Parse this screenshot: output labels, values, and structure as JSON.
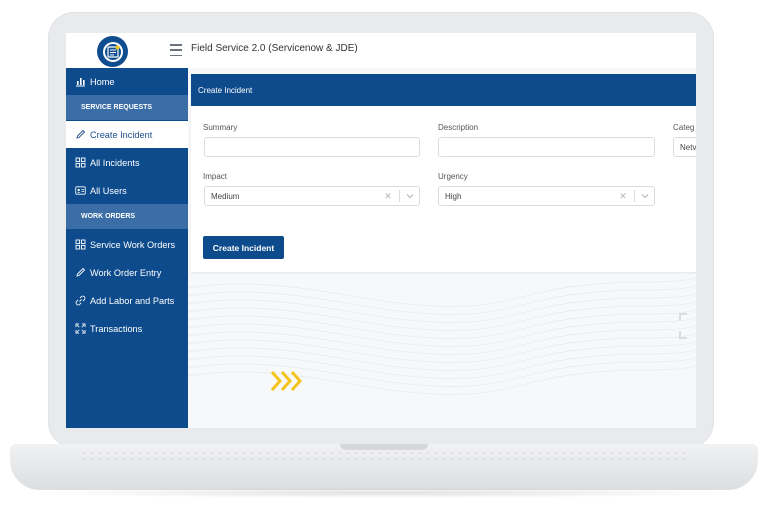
{
  "app": {
    "title": "Field Service 2.0 (Servicenow & JDE)"
  },
  "sidebar": {
    "items": [
      {
        "type": "link",
        "label": "Home",
        "icon": "chart-icon"
      },
      {
        "type": "section",
        "label": "SERVICE REQUESTS"
      },
      {
        "type": "link",
        "label": "Create Incident",
        "icon": "pencil-icon",
        "active": true
      },
      {
        "type": "link",
        "label": "All Incidents",
        "icon": "grid-icon"
      },
      {
        "type": "link",
        "label": "All Users",
        "icon": "id-card-icon"
      },
      {
        "type": "section",
        "label": "WORK ORDERS"
      },
      {
        "type": "link",
        "label": "Service Work Orders",
        "icon": "grid-icon"
      },
      {
        "type": "link",
        "label": "Work Order Entry",
        "icon": "pencil-icon"
      },
      {
        "type": "link",
        "label": "Add Labor and Parts",
        "icon": "link-icon"
      },
      {
        "type": "link",
        "label": "Transactions",
        "icon": "expand-icon"
      }
    ]
  },
  "form": {
    "header": "Create Incident",
    "summary": {
      "label": "Summary",
      "value": ""
    },
    "description": {
      "label": "Description",
      "value": ""
    },
    "category": {
      "label": "Categ",
      "value": "Netv"
    },
    "impact": {
      "label": "Impact",
      "value": "Medium"
    },
    "urgency": {
      "label": "Urgency",
      "value": "High"
    },
    "submit_label": "Create Incident"
  },
  "colors": {
    "primary": "#0d4b8c",
    "section": "#3b6ea6",
    "accent": "#f3c41b"
  }
}
